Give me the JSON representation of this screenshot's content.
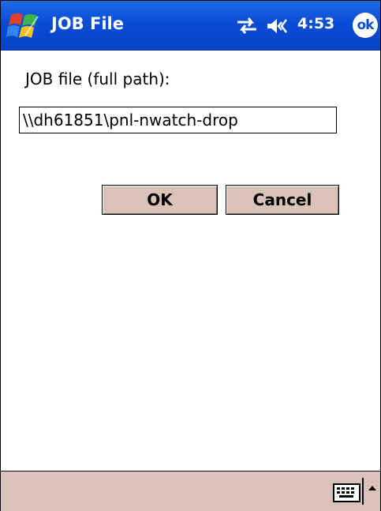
{
  "titlebar": {
    "title": "JOB File",
    "clock": "4:53",
    "ok_label": "ok"
  },
  "form": {
    "label": "JOB file (full path):",
    "path_value": "\\\\dh61851\\pnl-nwatch-drop"
  },
  "buttons": {
    "ok": "OK",
    "cancel": "Cancel"
  },
  "menubar": {
    "input_icon": "keyboard-icon",
    "sip_icon": "up-arrow-icon"
  },
  "colors": {
    "titlebar": "#0a4cd6",
    "button_face": "#d9c3b9",
    "menubar": "#d9c3b9"
  }
}
